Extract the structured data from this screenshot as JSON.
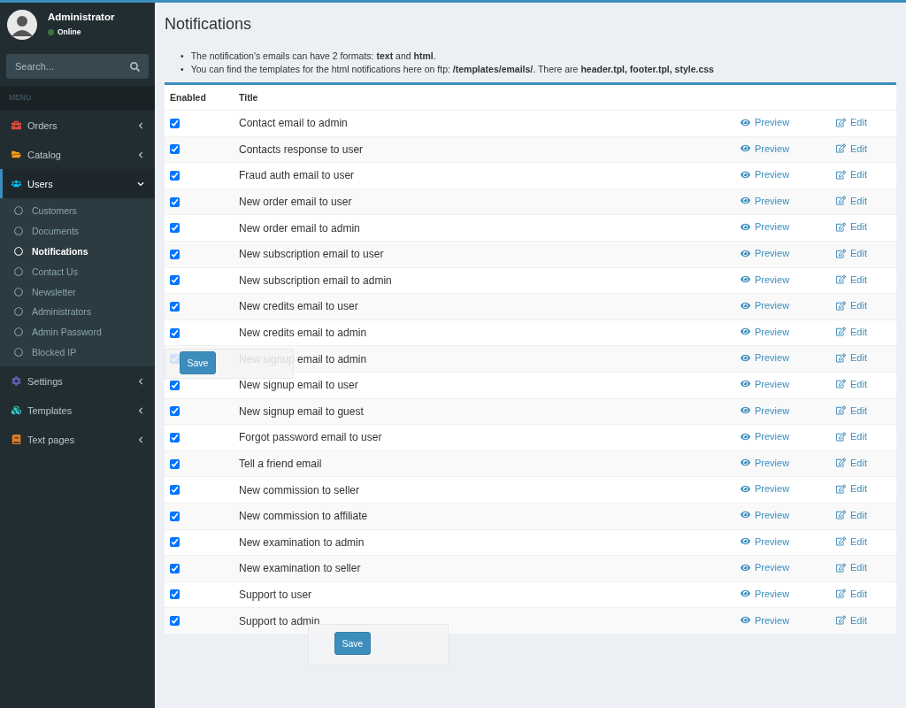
{
  "user": {
    "name": "Administrator",
    "status": "Online"
  },
  "search": {
    "placeholder": "Search..."
  },
  "menu_header": "MENU",
  "sidebar": {
    "items": [
      {
        "label": "Orders",
        "kind": "briefcase",
        "expanded": false,
        "selected": false
      },
      {
        "label": "Catalog",
        "kind": "folder",
        "expanded": false,
        "selected": false
      },
      {
        "label": "Users",
        "kind": "users",
        "expanded": true,
        "selected": true,
        "children": [
          {
            "label": "Customers",
            "selected": false
          },
          {
            "label": "Documents",
            "selected": false
          },
          {
            "label": "Notifications",
            "selected": true
          },
          {
            "label": "Contact Us",
            "selected": false
          },
          {
            "label": "Newsletter",
            "selected": false
          },
          {
            "label": "Administrators",
            "selected": false
          },
          {
            "label": "Admin Password",
            "selected": false
          },
          {
            "label": "Blocked IP",
            "selected": false
          }
        ]
      },
      {
        "label": "Settings",
        "kind": "gear",
        "expanded": false,
        "selected": false
      },
      {
        "label": "Templates",
        "kind": "cubes",
        "expanded": false,
        "selected": false
      },
      {
        "label": "Text pages",
        "kind": "book",
        "expanded": false,
        "selected": false
      }
    ]
  },
  "page_title": "Notifications",
  "notes": [
    {
      "bullet": "•",
      "text": "The notification's emails can have 2 formats: **text** and **html**."
    },
    {
      "bullet": "•",
      "text": "You can find the templates for the html notifications here on ftp: **/templates/emails/**. There are **header.tpl, footer.tpl, style.css**"
    }
  ],
  "table": {
    "columns": [
      "Enabled",
      "Title"
    ],
    "rows": [
      {
        "enabled": true,
        "title": "Contact email to admin",
        "preview": "Preview",
        "edit": "Edit"
      },
      {
        "enabled": true,
        "title": "Contacts response to user",
        "preview": "Preview",
        "edit": "Edit"
      },
      {
        "enabled": true,
        "title": "Fraud auth email to user",
        "preview": "Preview",
        "edit": "Edit"
      },
      {
        "enabled": true,
        "title": "New order email to user",
        "preview": "Preview",
        "edit": "Edit"
      },
      {
        "enabled": true,
        "title": "New order email to admin",
        "preview": "Preview",
        "edit": "Edit"
      },
      {
        "enabled": true,
        "title": "New subscription email to user",
        "preview": "Preview",
        "edit": "Edit"
      },
      {
        "enabled": true,
        "title": "New subscription email to admin",
        "preview": "Preview",
        "edit": "Edit"
      },
      {
        "enabled": true,
        "title": "New credits email to user",
        "preview": "Preview",
        "edit": "Edit"
      },
      {
        "enabled": true,
        "title": "New credits email to admin",
        "preview": "Preview",
        "edit": "Edit"
      },
      {
        "enabled": true,
        "title": "New signup email to admin",
        "preview": "Preview",
        "edit": "Edit"
      },
      {
        "enabled": true,
        "title": "New signup email to user",
        "preview": "Preview",
        "edit": "Edit"
      },
      {
        "enabled": true,
        "title": "New signup email to guest",
        "preview": "Preview",
        "edit": "Edit"
      },
      {
        "enabled": true,
        "title": "Forgot password email to user",
        "preview": "Preview",
        "edit": "Edit"
      },
      {
        "enabled": true,
        "title": "Tell a friend email",
        "preview": "Preview",
        "edit": "Edit"
      },
      {
        "enabled": true,
        "title": "New commission to seller",
        "preview": "Preview",
        "edit": "Edit"
      },
      {
        "enabled": true,
        "title": "New commission to affiliate",
        "preview": "Preview",
        "edit": "Edit"
      },
      {
        "enabled": true,
        "title": "New examination to admin",
        "preview": "Preview",
        "edit": "Edit"
      },
      {
        "enabled": true,
        "title": "New examination to seller",
        "preview": "Preview",
        "edit": "Edit"
      },
      {
        "enabled": true,
        "title": "Support to user",
        "preview": "Preview",
        "edit": "Edit"
      },
      {
        "enabled": true,
        "title": "Support to admin",
        "preview": "Preview",
        "edit": "Edit"
      }
    ]
  },
  "save_buttons": [
    "Save",
    "Save"
  ]
}
